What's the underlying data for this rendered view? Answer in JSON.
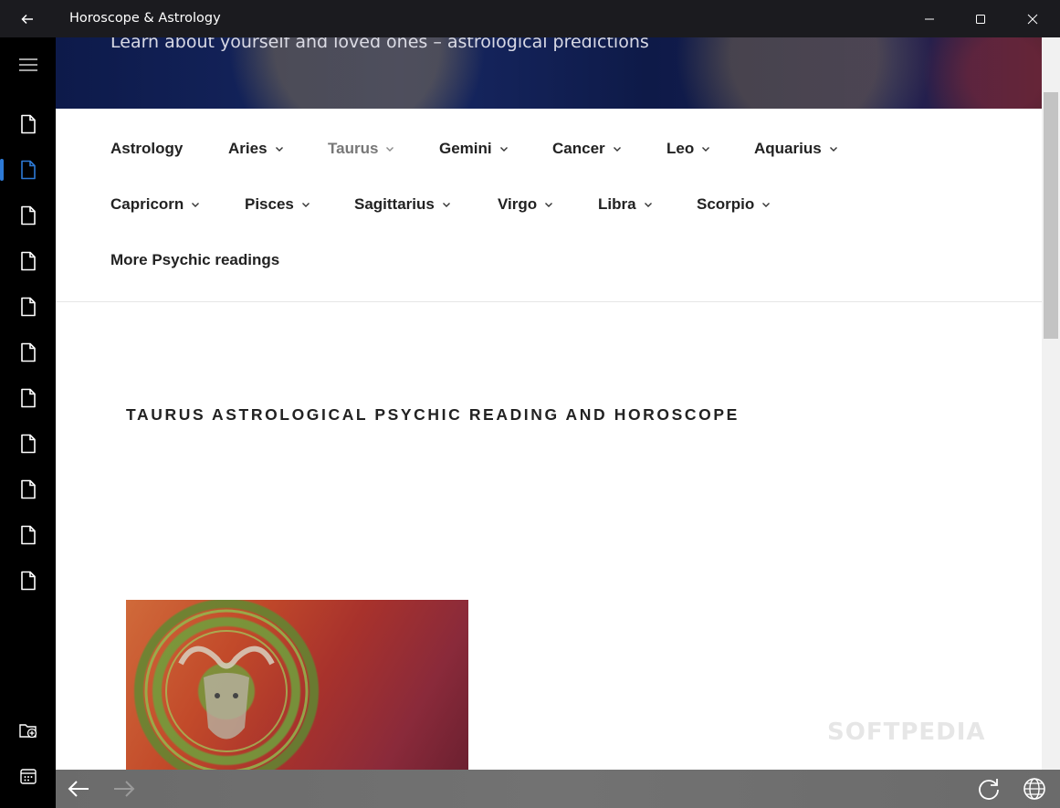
{
  "window": {
    "title": "Horoscope & Astrology"
  },
  "rail": {
    "items": [
      {
        "icon": "page-icon"
      },
      {
        "icon": "page-icon",
        "active": true
      },
      {
        "icon": "page-icon"
      },
      {
        "icon": "page-icon"
      },
      {
        "icon": "page-icon"
      },
      {
        "icon": "page-icon"
      },
      {
        "icon": "page-icon"
      },
      {
        "icon": "page-icon"
      },
      {
        "icon": "page-icon"
      },
      {
        "icon": "page-icon"
      },
      {
        "icon": "page-icon"
      }
    ],
    "bottom_icons": [
      "add-folder-icon",
      "calendar-icon"
    ]
  },
  "site": {
    "tagline": "Learn about yourself and loved ones – astrological predictions",
    "nav": {
      "astrology": "Astrology",
      "aries": "Aries",
      "taurus": "Taurus",
      "gemini": "Gemini",
      "cancer": "Cancer",
      "leo": "Leo",
      "aquarius": "Aquarius",
      "capricorn": "Capricorn",
      "pisces": "Pisces",
      "sagittarius": "Sagittarius",
      "virgo": "Virgo",
      "libra": "Libra",
      "scorpio": "Scorpio",
      "more": "More Psychic readings"
    },
    "heading": "TAURUS ASTROLOGICAL PSYCHIC READING AND HOROSCOPE",
    "watermark": "SOFTPEDIA"
  },
  "colors": {
    "titlebar": "#1b1b1f",
    "rail": "#000000",
    "accent": "#2d7ad6",
    "bottombar": "#6e6e6e"
  }
}
